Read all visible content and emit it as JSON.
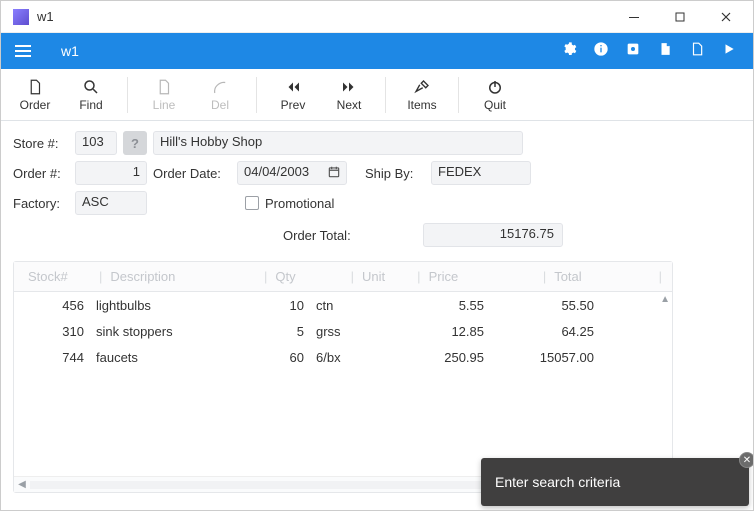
{
  "window": {
    "title": "w1"
  },
  "topbar": {
    "title": "w1"
  },
  "toolbar": {
    "order": "Order",
    "find": "Find",
    "line": "Line",
    "del": "Del",
    "prev": "Prev",
    "next": "Next",
    "items": "Items",
    "quit": "Quit"
  },
  "form": {
    "store_label": "Store #:",
    "store_no": "103",
    "store_help": "?",
    "store_name": "Hill's Hobby Shop",
    "order_label": "Order #:",
    "order_no": "1",
    "order_date_label": "Order Date:",
    "order_date": "04/04/2003",
    "shipby_label": "Ship By:",
    "shipby": "FEDEX",
    "factory_label": "Factory:",
    "factory": "ASC",
    "promotional_label": "Promotional",
    "promotional_checked": false,
    "order_total_label": "Order Total:",
    "order_total": "15176.75"
  },
  "grid": {
    "headers": {
      "stock": "Stock#",
      "description": "Description",
      "qty": "Qty",
      "unit": "Unit",
      "price": "Price",
      "total": "Total"
    },
    "rows": [
      {
        "stock": "456",
        "desc": "lightbulbs",
        "qty": "10",
        "unit": "ctn",
        "price": "5.55",
        "total": "55.50"
      },
      {
        "stock": "310",
        "desc": "sink stoppers",
        "qty": "5",
        "unit": "grss",
        "price": "12.85",
        "total": "64.25"
      },
      {
        "stock": "744",
        "desc": "faucets",
        "qty": "60",
        "unit": "6/bx",
        "price": "250.95",
        "total": "15057.00"
      }
    ]
  },
  "toast": {
    "text": "Enter search criteria"
  }
}
